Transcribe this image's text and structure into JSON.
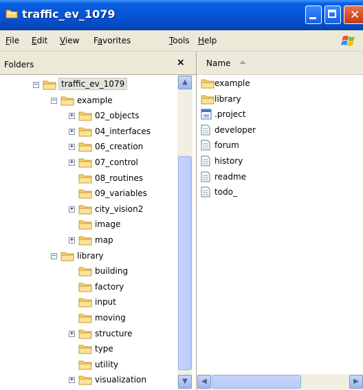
{
  "window": {
    "title": "traffic_ev_1079"
  },
  "menu": [
    {
      "label": "File",
      "ul": "F",
      "rest": "ile"
    },
    {
      "label": "Edit",
      "ul": "E",
      "rest": "dit"
    },
    {
      "label": "View",
      "ul": "V",
      "rest": "iew"
    },
    {
      "label": "Favorites",
      "ul": "",
      "pre": "F",
      "ul2": "a",
      "rest": "vorites"
    },
    {
      "label": "Tools",
      "ul": "T",
      "rest": "ools"
    },
    {
      "label": "Help",
      "ul": "H",
      "rest": "elp"
    }
  ],
  "folders": {
    "label": "Folders",
    "close": "×",
    "tree": [
      {
        "label": "traffic_ev_1079",
        "level": 0,
        "expander": "minus",
        "selected": true,
        "open": true
      },
      {
        "label": "example",
        "level": 1,
        "expander": "minus",
        "open": true
      },
      {
        "label": "02_objects",
        "level": 2,
        "expander": "plus"
      },
      {
        "label": "04_interfaces",
        "level": 2,
        "expander": "plus"
      },
      {
        "label": "06_creation",
        "level": 2,
        "expander": "plus"
      },
      {
        "label": "07_control",
        "level": 2,
        "expander": "plus"
      },
      {
        "label": "08_routines",
        "level": 2,
        "expander": "none"
      },
      {
        "label": "09_variables",
        "level": 2,
        "expander": "none"
      },
      {
        "label": "city_vision2",
        "level": 2,
        "expander": "plus"
      },
      {
        "label": "image",
        "level": 2,
        "expander": "none"
      },
      {
        "label": "map",
        "level": 2,
        "expander": "plus"
      },
      {
        "label": "library",
        "level": 1,
        "expander": "minus",
        "open": true
      },
      {
        "label": "building",
        "level": 2,
        "expander": "none"
      },
      {
        "label": "factory",
        "level": 2,
        "expander": "none"
      },
      {
        "label": "input",
        "level": 2,
        "expander": "none"
      },
      {
        "label": "moving",
        "level": 2,
        "expander": "none"
      },
      {
        "label": "structure",
        "level": 2,
        "expander": "plus"
      },
      {
        "label": "type",
        "level": 2,
        "expander": "none"
      },
      {
        "label": "utility",
        "level": 2,
        "expander": "none"
      },
      {
        "label": "visualization",
        "level": 2,
        "expander": "plus"
      }
    ]
  },
  "files": {
    "column_name": "Name",
    "items": [
      {
        "label": "example",
        "icon": "folder-icon"
      },
      {
        "label": "library",
        "icon": "folder-icon"
      },
      {
        "label": ".project",
        "icon": "project-file-icon"
      },
      {
        "label": "developer",
        "icon": "text-file-icon"
      },
      {
        "label": "forum",
        "icon": "text-file-icon"
      },
      {
        "label": "history",
        "icon": "text-file-icon"
      },
      {
        "label": "readme",
        "icon": "text-file-icon"
      },
      {
        "label": "todo_",
        "icon": "text-file-icon"
      }
    ]
  },
  "colors": {
    "titlebar": "#0654d6",
    "folder": "#f5d36b",
    "selection": "#e4e3dc"
  }
}
